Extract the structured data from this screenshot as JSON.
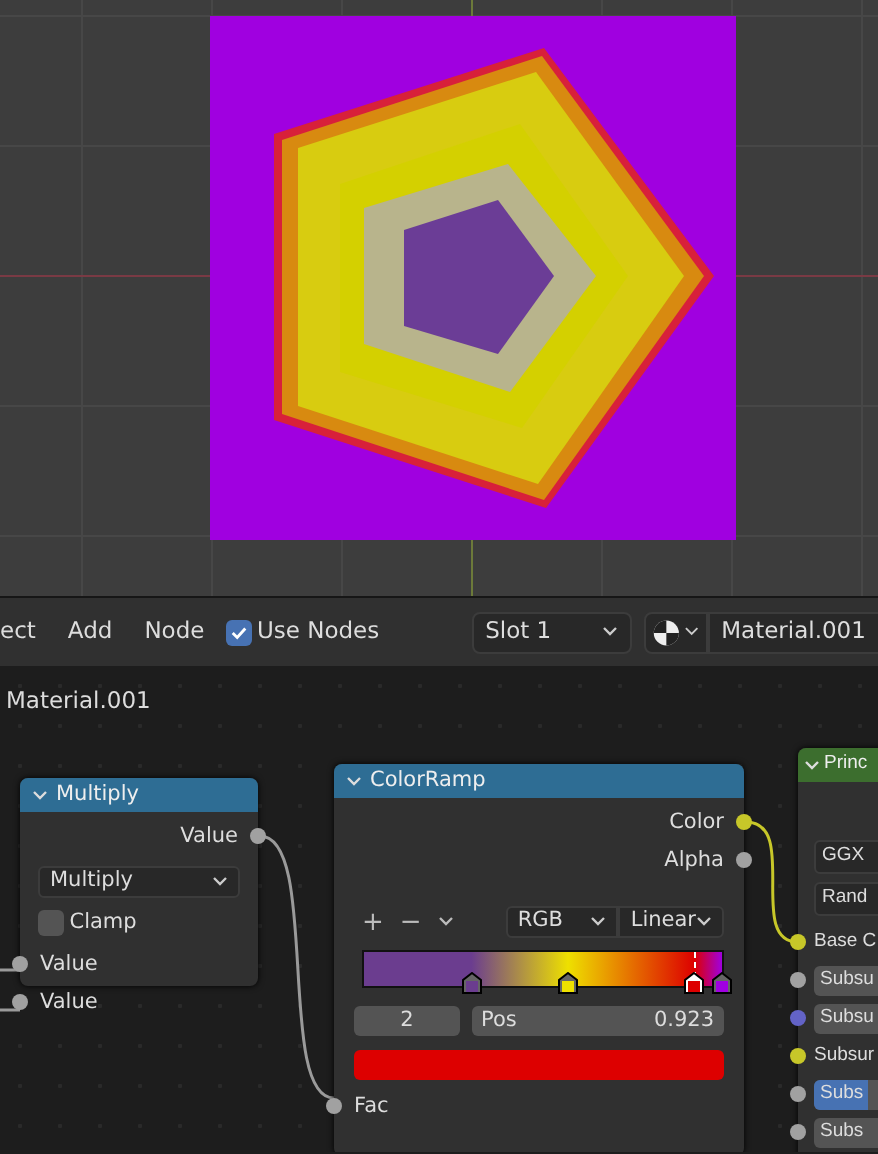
{
  "header": {
    "menu": [
      "ect",
      "Add",
      "Node"
    ],
    "use_nodes": {
      "label": "Use Nodes",
      "checked": true
    },
    "slot": "Slot 1",
    "material": "Material.001"
  },
  "breadcrumb": "Material.001",
  "multiply": {
    "title": "Multiply",
    "outputs": [
      {
        "label": "Value",
        "color": "#a1a1a1"
      }
    ],
    "operation": "Multiply",
    "clamp": {
      "label": "Clamp",
      "checked": false
    },
    "inputs": [
      {
        "label": "Value",
        "color": "#a1a1a1"
      },
      {
        "label": "Value",
        "color": "#a1a1a1"
      }
    ]
  },
  "colorramp": {
    "title": "ColorRamp",
    "outputs": [
      {
        "label": "Color",
        "color": "#c7c729"
      },
      {
        "label": "Alpha",
        "color": "#a1a1a1"
      }
    ],
    "tools": [
      "+",
      "−"
    ],
    "color_mode": "RGB",
    "interpolation": "Linear",
    "stops": [
      {
        "level": 0.3,
        "color": "#6b3d8f",
        "selected": false
      },
      {
        "level": 0.57,
        "color": "#eee000",
        "selected": false
      },
      {
        "level": 0.923,
        "color": "#dd0000",
        "selected": true
      },
      {
        "level": 1.0,
        "color": "#a000e0",
        "selected": false
      }
    ],
    "active_index": "2",
    "pos_label": "Pos",
    "pos_value": "0.923",
    "swatch": {
      "color": "#dd0000"
    },
    "inputs": [
      {
        "label": "Fac",
        "color": "#a1a1a1"
      }
    ]
  },
  "principled": {
    "title": "Princ",
    "fields": [
      "GGX",
      "Rand"
    ],
    "rows": [
      {
        "kind": "socket",
        "label": "Base C",
        "color": "#c7c729"
      },
      {
        "kind": "field",
        "label": "Subsu",
        "color": "#a1a1a1"
      },
      {
        "kind": "field",
        "label": "Subsu",
        "color": "#6363c7"
      },
      {
        "kind": "socket",
        "label": "Subsur",
        "color": "#c7c729"
      },
      {
        "kind": "slider",
        "label": "Subs",
        "color": "#a1a1a1",
        "level": 0.45
      },
      {
        "kind": "field",
        "label": "Subs",
        "color": "#a1a1a1"
      }
    ]
  }
}
